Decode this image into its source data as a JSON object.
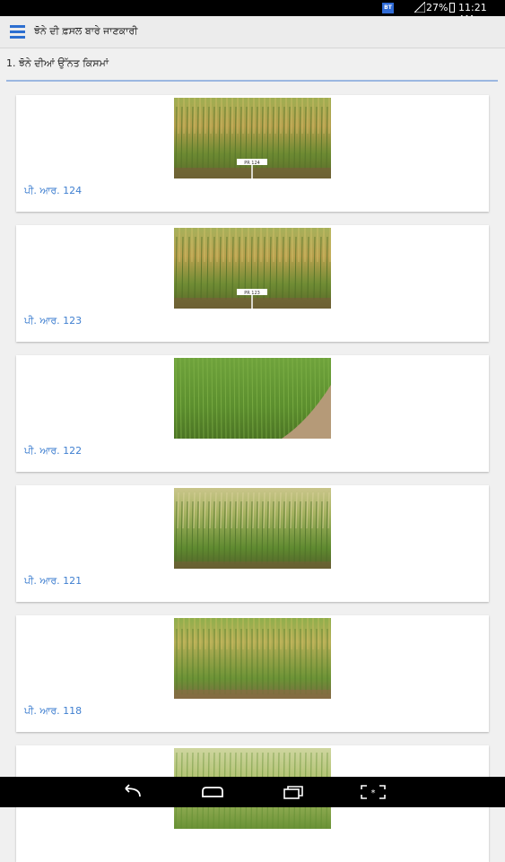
{
  "status_bar": {
    "badge": "BT",
    "battery": "27%",
    "time": "11:21 AM"
  },
  "app_bar": {
    "title": "ਝੋਨੇ ਦੀ ਫ਼ਸਲ ਬਾਰੇ ਜਾਣਕਾਰੀ"
  },
  "question": "1. ਝੋਨੇ ਦੀਆਂ ਉੱਨਤ ਕਿਸਮਾਂ",
  "varieties": [
    {
      "caption": "ਪੀ. ਆਰ. 124",
      "photo_label": "PR 124"
    },
    {
      "caption": "ਪੀ. ਆਰ. 123",
      "photo_label": "PR 123"
    },
    {
      "caption": "ਪੀ. ਆਰ. 122",
      "photo_label": ""
    },
    {
      "caption": "ਪੀ. ਆਰ. 121",
      "photo_label": ""
    },
    {
      "caption": "ਪੀ. ਆਰ. 118",
      "photo_label": ""
    },
    {
      "caption": "",
      "photo_label": ""
    }
  ],
  "icons": {
    "menu": "hamburger-icon",
    "back": "back-icon",
    "home": "home-icon",
    "recents": "recents-icon",
    "screenshot": "screenshot-icon"
  },
  "colors": {
    "accent": "#2d6fd0",
    "caption": "#3f7fd0",
    "divider": "#9bb7e0"
  }
}
